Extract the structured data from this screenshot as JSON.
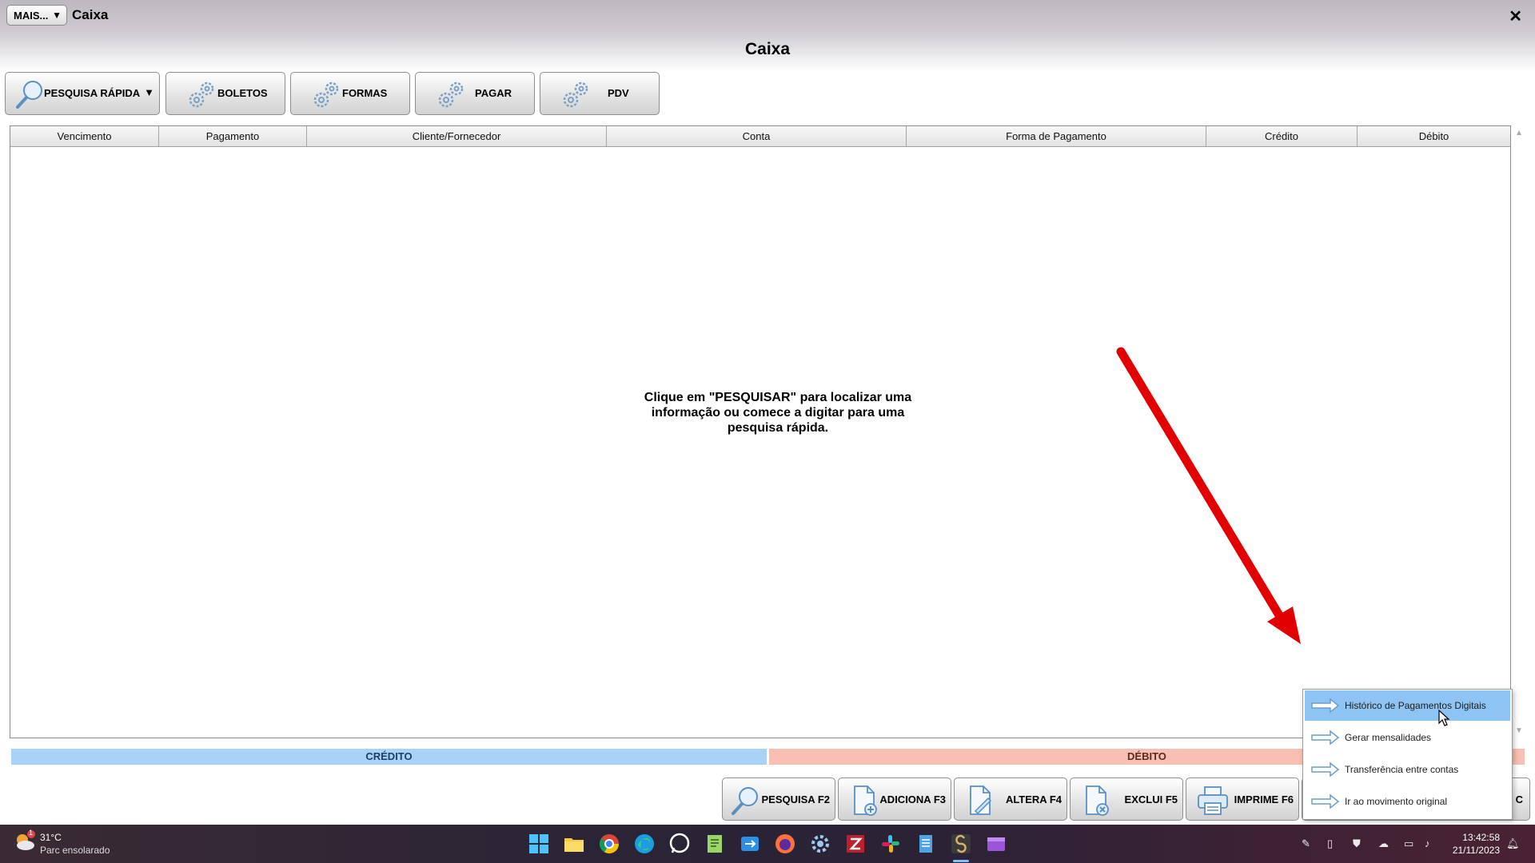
{
  "window": {
    "more_label": "MAIS...",
    "title": "Caixa",
    "close": "✕"
  },
  "page_title": "Caixa",
  "toolbar": [
    {
      "label": "PESQUISA RÁPIDA"
    },
    {
      "label": "BOLETOS"
    },
    {
      "label": "FORMAS"
    },
    {
      "label": "PAGAR"
    },
    {
      "label": "PDV"
    }
  ],
  "grid": {
    "columns": [
      "Vencimento",
      "Pagamento",
      "Cliente/Fornecedor",
      "Conta",
      "Forma de Pagamento",
      "Crédito",
      "Débito"
    ],
    "empty_message_lines": [
      "Clique em \"PESQUISAR\" para localizar uma",
      "informação ou comece a digitar para uma",
      "pesquisa rápida."
    ]
  },
  "totals": {
    "credit": "CRÉDITO",
    "debit": "DÉBITO"
  },
  "bottom_buttons": [
    {
      "label": "PESQUISA F2"
    },
    {
      "label": "ADICIONA F3"
    },
    {
      "label": "ALTERA F4"
    },
    {
      "label": "EXCLUI F5"
    },
    {
      "label": "IMPRIME F6"
    },
    {
      "label": "C"
    }
  ],
  "popup_menu": [
    {
      "label": "Histórico de Pagamentos Digitais",
      "active": true
    },
    {
      "label": "Gerar mensalidades"
    },
    {
      "label": "Transferência entre contas"
    },
    {
      "label": "Ir ao movimento original"
    }
  ],
  "taskbar": {
    "weather_temp": "31°C",
    "weather_desc": "Parc ensolarado",
    "weather_badge": "1",
    "time": "13:42:58",
    "date": "21/11/2023"
  },
  "colors": {
    "credit_bar": "#a9d2f8",
    "debit_bar": "#f8c0b4",
    "menu_highlight": "#8ec4f3",
    "annotation_arrow": "#e30000"
  }
}
